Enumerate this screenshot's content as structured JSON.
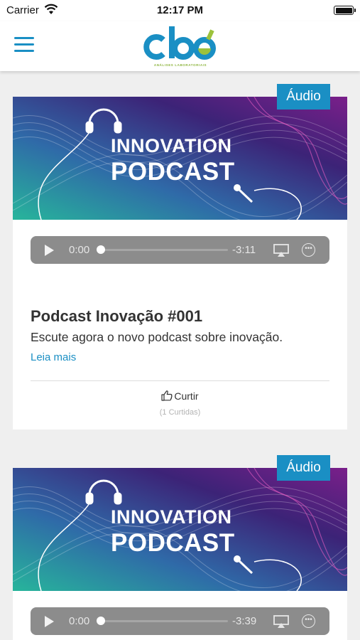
{
  "status_bar": {
    "carrier": "Carrier",
    "time": "12:17 PM"
  },
  "header": {
    "logo_text": "cbo",
    "logo_subtitle": "ANÁLISES LABORATORIAIS"
  },
  "colors": {
    "accent": "#1a8fc4",
    "logo_green": "#8cb43c",
    "badge": "#1a8fc4",
    "banner_purple": "#3b1f72",
    "banner_teal": "#1fa89e"
  },
  "icons": [
    "hamburger-menu-icon",
    "wifi-icon",
    "battery-icon",
    "headphones-icon",
    "microphone-icon",
    "play-icon",
    "airplay-icon",
    "more-options-icon",
    "thumbs-up-icon"
  ],
  "posts": [
    {
      "badge": "Áudio",
      "banner_line1": "INNOVATION",
      "banner_line2": "PODCAST",
      "current_time": "0:00",
      "remaining_time": "-3:11",
      "playback_progress": 0,
      "title": "Podcast Inovação #001",
      "description": "Escute agora o novo podcast sobre inovação.",
      "read_more": "Leia mais",
      "like_label": "Curtir",
      "like_count": "(1 Curtidas)"
    },
    {
      "badge": "Áudio",
      "banner_line1": "INNOVATION",
      "banner_line2": "PODCAST",
      "current_time": "0:00",
      "remaining_time": "-3:39",
      "playback_progress": 0
    }
  ]
}
